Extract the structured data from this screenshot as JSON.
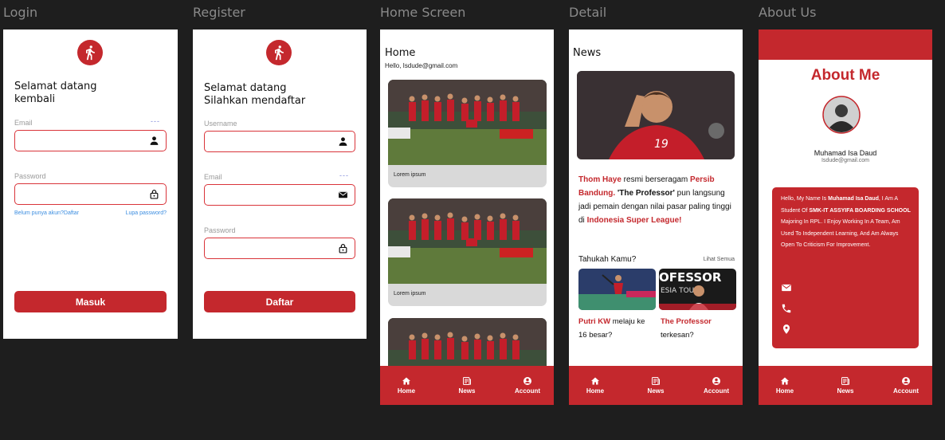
{
  "frames": {
    "login": "Login",
    "register": "Register",
    "home": "Home Screen",
    "detail": "Detail",
    "about": "About Us"
  },
  "login": {
    "greeting_line1": "Selamat datang",
    "greeting_line2": "kembali",
    "email_label": "Email",
    "password_label": "Password",
    "dots": "---",
    "no_account": "Belum punya akun?",
    "register_link": "Daftar",
    "forgot": "Lupa password?",
    "submit": "Masuk"
  },
  "register": {
    "greeting_line1": "Selamat datang",
    "greeting_line2": "Silahkan mendaftar",
    "username_label": "Username",
    "email_label": "Email",
    "password_label": "Password",
    "dots": "---",
    "submit": "Daftar"
  },
  "home": {
    "title": "Home",
    "hello": "Hello, Isdude@gmail.com",
    "cards": [
      {
        "caption": "Lorem ipsum"
      },
      {
        "caption": "Lorem ipsum"
      }
    ]
  },
  "detail": {
    "title": "News",
    "headline": {
      "p1": "Thom Haye",
      "p2": " resmi berseragam ",
      "p3": "Persib Bandung.",
      "p4": " 'The Professor'",
      "p5": " pun langsung jadi pemain dengan nilai pasar paling tinggi di ",
      "p6": "Indonesia Super League!"
    },
    "section_title": "Tahukah Kamu?",
    "see_all": "Lihat Semua",
    "items": [
      {
        "bold": "Putri KW",
        "rest": " melaju ke 16 besar?"
      },
      {
        "bold": "The Professor",
        "rest": " terkesan?"
      }
    ]
  },
  "about": {
    "title": "About Me",
    "name": "Muhamad Isa Daud",
    "email": "Isdude@gmail.com",
    "bio": {
      "t1": "Hello, My Name Is ",
      "b1": "Muhamad Isa Daud",
      "t2": ", I Am A Student Of ",
      "b2": "SMK-IT ASSYIFA BOARDING SCHOOL",
      "t3": " Majoring In RPL. I Enjoy Working In A Team, Am Used To Independent Learning, And Am Always Open To Criticism For Improvement."
    }
  },
  "nav": {
    "home": "Home",
    "news": "News",
    "account": "Account"
  },
  "colors": {
    "accent": "#c4282d",
    "background": "#1e1e1e",
    "link": "#3b8de0"
  },
  "icons": [
    "runner-logo-icon",
    "person-icon",
    "lock-icon",
    "mail-icon",
    "phone-icon",
    "location-icon",
    "home-icon",
    "news-icon",
    "account-icon"
  ]
}
